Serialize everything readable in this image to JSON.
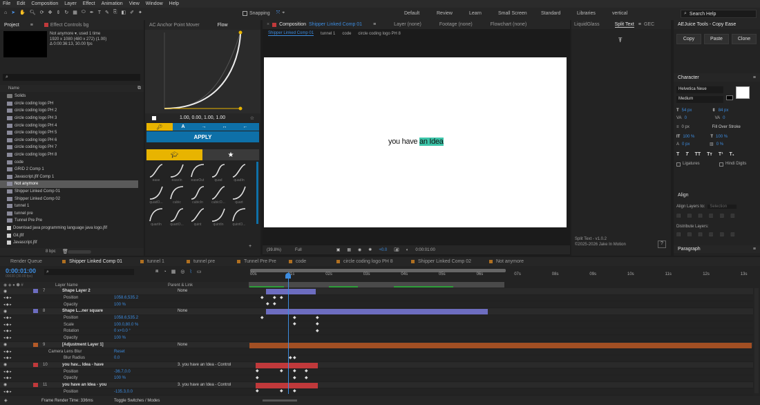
{
  "menu": [
    "File",
    "Edit",
    "Composition",
    "Layer",
    "Effect",
    "Animation",
    "View",
    "Window",
    "Help"
  ],
  "toolbar": {
    "snapping": "Snapping",
    "workspaces": [
      "Default",
      "Review",
      "Learn",
      "Small Screen",
      "Standard",
      "Libraries",
      "vertical"
    ],
    "search": "Search Help"
  },
  "project": {
    "tab": "Project",
    "effect_controls": "Effect Controls bg",
    "selected_name": "Not anymore ▾, used 1 time",
    "selected_info": [
      "1920 x 1080 (480 x 272) (1.00)",
      "Δ 0:00:36:13, 30.00 fps"
    ],
    "col_name": "Name",
    "items": [
      {
        "name": "Solids",
        "type": "folder"
      },
      {
        "name": "circle coding logo PH",
        "type": "comp"
      },
      {
        "name": "circle coding logo PH 2",
        "type": "comp"
      },
      {
        "name": "circle coding logo PH 3",
        "type": "comp"
      },
      {
        "name": "circle coding logo PH 4",
        "type": "comp"
      },
      {
        "name": "circle coding logo PH 5",
        "type": "comp"
      },
      {
        "name": "circle coding logo PH 6",
        "type": "comp"
      },
      {
        "name": "circle coding logo PH 7",
        "type": "comp"
      },
      {
        "name": "circle coding logo PH 8",
        "type": "comp"
      },
      {
        "name": "code",
        "type": "comp"
      },
      {
        "name": "GRID 2 Comp 1",
        "type": "comp"
      },
      {
        "name": "Javascript.jfif Comp 1",
        "type": "comp"
      },
      {
        "name": "Not anymore",
        "type": "comp",
        "selected": true
      },
      {
        "name": "Shipper Linked Comp 01",
        "type": "comp"
      },
      {
        "name": "Shipper Linked Comp 02",
        "type": "comp"
      },
      {
        "name": "tunnel 1",
        "type": "comp"
      },
      {
        "name": "tunnel pre",
        "type": "comp"
      },
      {
        "name": "Tunnel Pre Pre",
        "type": "comp"
      },
      {
        "name": "Download java programming language java logo.jfif",
        "type": "file"
      },
      {
        "name": "Git.jfif",
        "type": "file"
      },
      {
        "name": "Javascript.jfif",
        "type": "file"
      }
    ],
    "bpc": "8 bpc"
  },
  "flow": {
    "tab1": "AC Anchor Point Mover",
    "tab2": "Flow",
    "values": "1.00, 0.00, 1.00, 1.00",
    "apply": "APPLY",
    "presets_row1": [
      "ease",
      "easeIn",
      "easeOut",
      "quad",
      "quadIn"
    ],
    "presets_row2": [
      "quadO...",
      "cubic",
      "cubicIn",
      "cubicO...",
      "quart"
    ],
    "presets_row3": [
      "quartIn",
      "quartO...",
      "quint",
      "quintIn",
      "quintO..."
    ]
  },
  "composition": {
    "tab": "Composition",
    "comp_name": "Shipper Linked Comp 01",
    "layer_tab": "Layer (none)",
    "footage_tab": "Footage (none)",
    "flowchart_tab": "Flowchart (none)",
    "crumbs": [
      "Shipper Linked Comp 01",
      "tunnel 1",
      "code",
      "circle coding logo PH 8"
    ],
    "text_plain": "you have ",
    "text_highlight": "an Idea",
    "highlight_color": "#3cc4a8",
    "zoom": "(39.8%)",
    "resolution": "Full",
    "exposure": "+0.0",
    "time": "0:00:01:00"
  },
  "right": {
    "tabs": [
      "LiquidGlass",
      "Split Text",
      "GEC"
    ],
    "version": "Split Text - v1.0.2",
    "copyright": "©2025-2026 Jake In Motion",
    "aejuice": "AEJuice Tools - Copy Ease",
    "copy": "Copy",
    "paste": "Paste",
    "clone": "Clone",
    "character": "Character",
    "font": "Helvetica Neue",
    "style": "Medium",
    "font_size": "54 px",
    "leading": "84 px",
    "kerning": "0",
    "tracking": "0",
    "stroke": "0 px",
    "stroke_type": "Fill Over Stroke",
    "v_scale": "100 %",
    "h_scale": "100 %",
    "baseline": "0 px",
    "tsume": "0 %",
    "ligatures": "Ligatures",
    "hindi": "Hindi Digits",
    "align": "Align",
    "align_to": "Align Layers to:",
    "selection": "Selection",
    "distribute": "Distribute Layers:",
    "paragraph": "Paragraph"
  },
  "timeline": {
    "tabs": [
      "Render Queue",
      "Shipper Linked Comp 01",
      "tunnel 1",
      "tunnel pre",
      "Tunnel Pre Pre",
      "code",
      "circle coding logo PH 8",
      "Shipper Linked Comp 02",
      "Not anymore"
    ],
    "timecode": "0:00:01:00",
    "timecode_sub": "00030 (30.00 fps)",
    "col_layer": "Layer Name",
    "col_parent": "Parent & Link",
    "ruler": [
      "00s",
      "01s",
      "02s",
      "03s",
      "04s",
      "05s",
      "06s",
      "07s",
      "08s",
      "09s",
      "10s",
      "11s",
      "12s",
      "13s"
    ],
    "rows": [
      {
        "num": "7",
        "name": "Shape Layer 2",
        "kind": "layer",
        "color": "#6d6dc0",
        "parent": "None"
      },
      {
        "name": "Position",
        "kind": "prop",
        "value": "1058.6,535.2"
      },
      {
        "name": "Opacity",
        "kind": "prop",
        "value": "100 %"
      },
      {
        "num": "8",
        "name": "Shape L...ner square",
        "kind": "layer",
        "color": "#6d6dc0",
        "parent": "None"
      },
      {
        "name": "Position",
        "kind": "prop",
        "value": "1058.6,535.2"
      },
      {
        "name": "Scale",
        "kind": "prop",
        "value": "100.0,80.0 %"
      },
      {
        "name": "Rotation",
        "kind": "prop",
        "value": "0 x+0.0 °"
      },
      {
        "name": "Opacity",
        "kind": "prop",
        "value": "100 %"
      },
      {
        "num": "9",
        "name": "[Adjustment Layer 1]",
        "kind": "layer",
        "color": "#b45a28",
        "parent": "None"
      },
      {
        "name": "Camera Lens Blur",
        "kind": "fx",
        "value": "Reset"
      },
      {
        "name": "Blur Radius",
        "kind": "prop",
        "value": "0.0"
      },
      {
        "num": "10",
        "name": "you hav... Idea - have",
        "kind": "layer",
        "color": "#c0393b",
        "parent": "3. you have an Idea - Control"
      },
      {
        "name": "Position",
        "kind": "prop",
        "value": "-36.7,0.0"
      },
      {
        "name": "Opacity",
        "kind": "prop",
        "value": "100 %"
      },
      {
        "num": "11",
        "name": "you have an Idea - you",
        "kind": "layer",
        "color": "#c0393b",
        "parent": "3. you have an Idea - Control"
      },
      {
        "name": "Position",
        "kind": "prop",
        "value": "-135.3,0.0"
      }
    ],
    "footer_render": "Frame Render Time: 336ms",
    "footer_toggle": "Toggle Switches / Modes"
  }
}
